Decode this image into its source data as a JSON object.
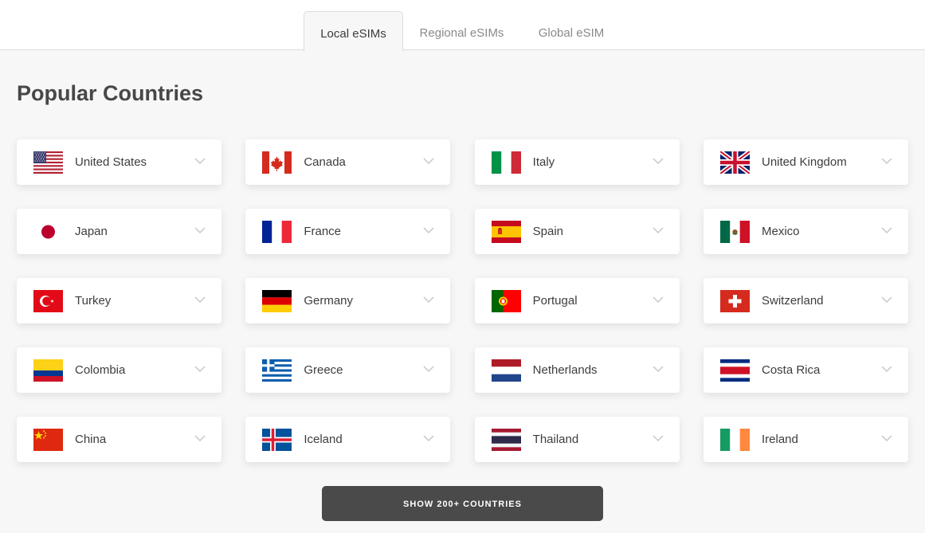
{
  "tabs": [
    {
      "label": "Local eSIMs",
      "active": true
    },
    {
      "label": "Regional eSIMs",
      "active": false
    },
    {
      "label": "Global eSIM",
      "active": false
    }
  ],
  "section_title": "Popular Countries",
  "countries": [
    {
      "name": "United States",
      "flag": "us-flag-icon"
    },
    {
      "name": "Canada",
      "flag": "canada-flag-icon"
    },
    {
      "name": "Italy",
      "flag": "italy-flag-icon"
    },
    {
      "name": "United Kingdom",
      "flag": "uk-flag-icon"
    },
    {
      "name": "Japan",
      "flag": "japan-flag-icon"
    },
    {
      "name": "France",
      "flag": "france-flag-icon"
    },
    {
      "name": "Spain",
      "flag": "spain-flag-icon"
    },
    {
      "name": "Mexico",
      "flag": "mexico-flag-icon"
    },
    {
      "name": "Turkey",
      "flag": "turkey-flag-icon"
    },
    {
      "name": "Germany",
      "flag": "germany-flag-icon"
    },
    {
      "name": "Portugal",
      "flag": "portugal-flag-icon"
    },
    {
      "name": "Switzerland",
      "flag": "switzerland-flag-icon"
    },
    {
      "name": "Colombia",
      "flag": "colombia-flag-icon"
    },
    {
      "name": "Greece",
      "flag": "greece-flag-icon"
    },
    {
      "name": "Netherlands",
      "flag": "netherlands-flag-icon"
    },
    {
      "name": "Costa Rica",
      "flag": "costa-rica-flag-icon"
    },
    {
      "name": "China",
      "flag": "china-flag-icon"
    },
    {
      "name": "Iceland",
      "flag": "iceland-flag-icon"
    },
    {
      "name": "Thailand",
      "flag": "thailand-flag-icon"
    },
    {
      "name": "Ireland",
      "flag": "ireland-flag-icon"
    }
  ],
  "show_more_label": "SHOW 200+ COUNTRIES",
  "colors": {
    "background": "#f7f7f7",
    "card": "#ffffff",
    "button": "#4a4a4a",
    "text": "#3d3d3d"
  }
}
